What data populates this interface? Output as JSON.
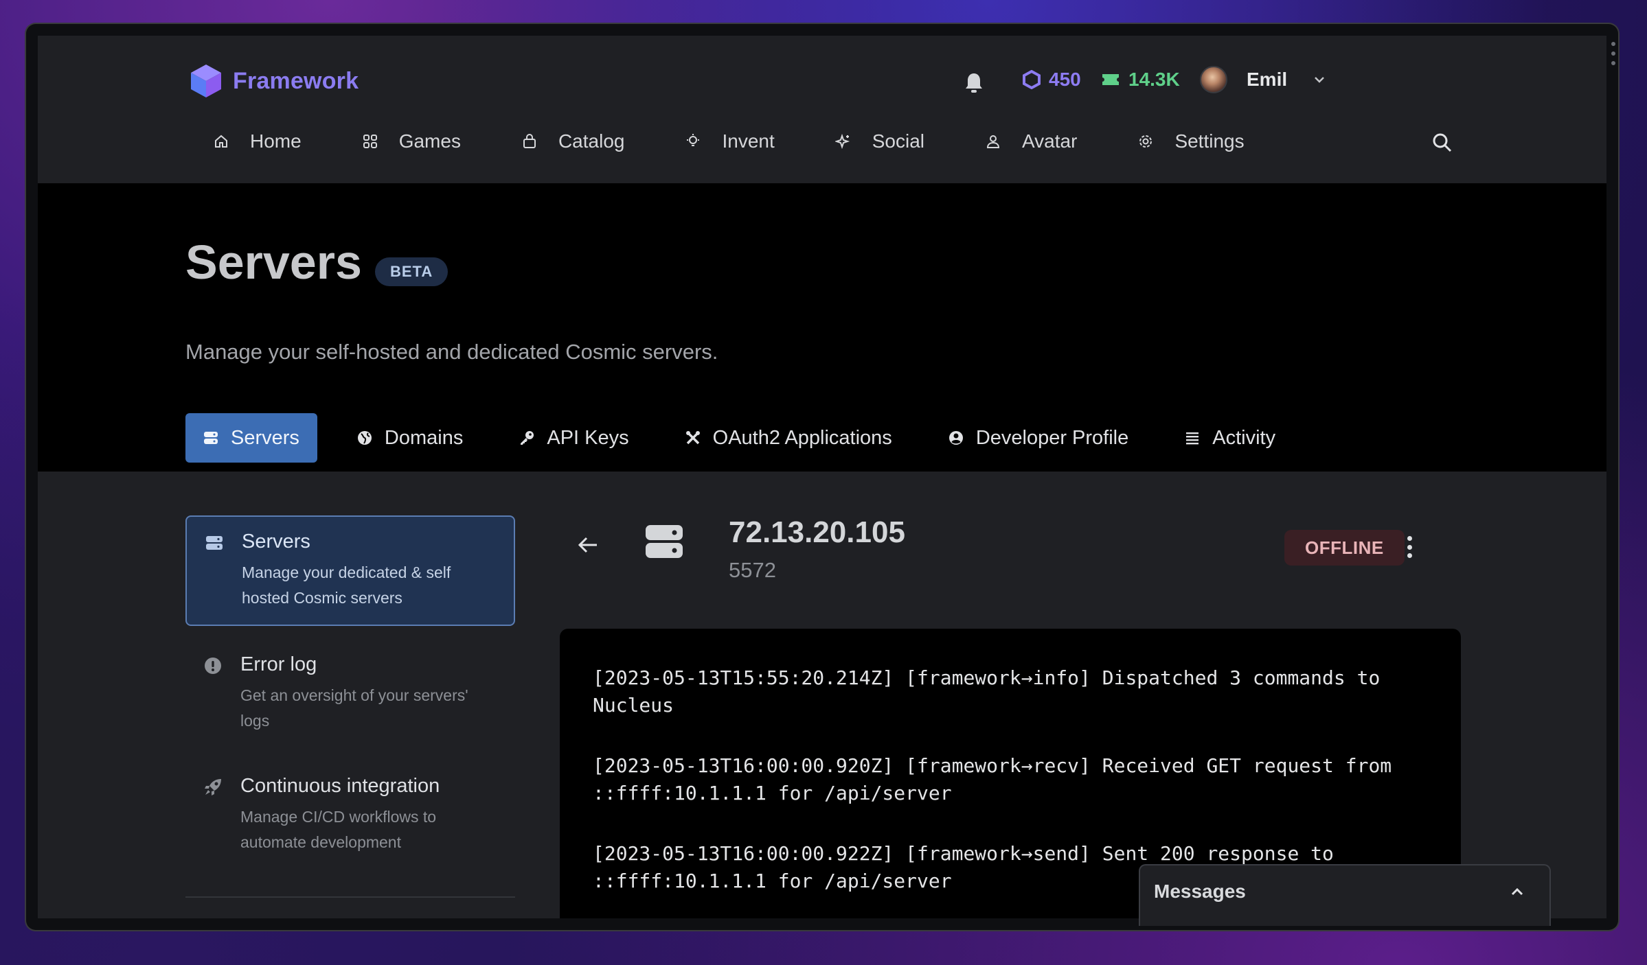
{
  "brand": {
    "name": "Framework",
    "accent": "#8b7cf0"
  },
  "topbar": {
    "robux": "450",
    "tix": "14.3K",
    "user_name": "Emil"
  },
  "nav": {
    "items": [
      {
        "label": "Home",
        "icon": "home-icon"
      },
      {
        "label": "Games",
        "icon": "grid-icon"
      },
      {
        "label": "Catalog",
        "icon": "bag-icon"
      },
      {
        "label": "Invent",
        "icon": "lightbulb-icon"
      },
      {
        "label": "Social",
        "icon": "sparkle-icon"
      },
      {
        "label": "Avatar",
        "icon": "person-icon"
      },
      {
        "label": "Settings",
        "icon": "gear-icon"
      }
    ]
  },
  "hero": {
    "title": "Servers",
    "badge": "BETA",
    "subtitle": "Manage your self-hosted and dedicated Cosmic servers."
  },
  "tabs": [
    {
      "label": "Servers",
      "icon": "server-icon",
      "active": true
    },
    {
      "label": "Domains",
      "icon": "globe-icon"
    },
    {
      "label": "API Keys",
      "icon": "key-icon"
    },
    {
      "label": "OAuth2 Applications",
      "icon": "tools-icon"
    },
    {
      "label": "Developer Profile",
      "icon": "user-circle-icon"
    },
    {
      "label": "Activity",
      "icon": "list-icon"
    }
  ],
  "sidebar": {
    "items": [
      {
        "title": "Servers",
        "desc": "Manage your dedicated & self hosted Cosmic servers",
        "icon": "server-icon",
        "active": true
      },
      {
        "title": "Error log",
        "desc": "Get an oversight of your servers' logs",
        "icon": "alert-icon"
      },
      {
        "title": "Continuous integration",
        "desc": "Manage CI/CD workflows to automate development",
        "icon": "rocket-icon"
      }
    ]
  },
  "server": {
    "ip": "72.13.20.105",
    "port": "5572",
    "status": "OFFLINE"
  },
  "logs": [
    "[2023-05-13T15:55:20.214Z] [framework→info] Dispatched 3 commands to Nucleus",
    "[2023-05-13T16:00:00.920Z] [framework→recv] Received GET request from ::ffff:10.1.1.1 for /api/server",
    "[2023-05-13T16:00:00.922Z] [framework→send] Sent 200 response to ::ffff:10.1.1.1 for /api/server"
  ],
  "messages": {
    "title": "Messages"
  }
}
